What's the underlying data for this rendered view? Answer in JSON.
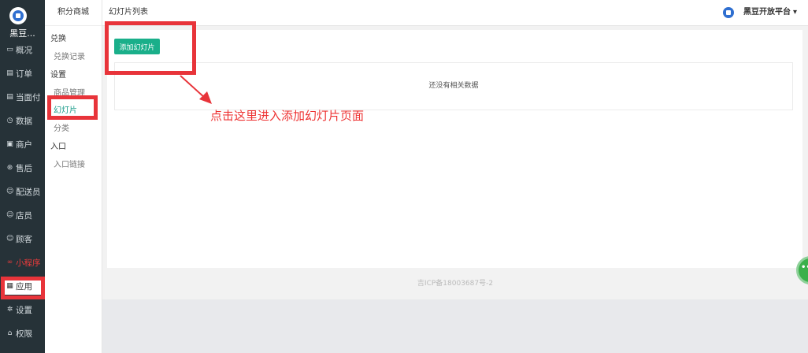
{
  "sidebar": {
    "brand": "黑豆...",
    "items": [
      {
        "label": "概况",
        "icon": "overview-icon"
      },
      {
        "label": "订单",
        "icon": "order-icon"
      },
      {
        "label": "当面付",
        "icon": "pay-icon"
      },
      {
        "label": "数据",
        "icon": "data-icon"
      },
      {
        "label": "商户",
        "icon": "merchant-icon"
      },
      {
        "label": "售后",
        "icon": "aftersale-icon"
      },
      {
        "label": "配送员",
        "icon": "courier-icon"
      },
      {
        "label": "店员",
        "icon": "clerk-icon"
      },
      {
        "label": "顾客",
        "icon": "customer-icon"
      },
      {
        "label": "小程序",
        "icon": "miniprogram-icon"
      },
      {
        "label": "应用",
        "icon": "apps-icon"
      },
      {
        "label": "设置",
        "icon": "settings-icon"
      },
      {
        "label": "权限",
        "icon": "lock-icon"
      }
    ]
  },
  "subnav": {
    "title": "积分商城",
    "group_exchange": "兑换",
    "exchange_records": "兑换记录",
    "group_settings": "设置",
    "product_management": "商品管理",
    "slides": "幻灯片",
    "categories": "分类",
    "group_entry": "入口",
    "entry_link": "入口链接"
  },
  "header": {
    "breadcrumb": "幻灯片列表",
    "platform_name": "黑豆开放平台",
    "caret": "▾"
  },
  "main": {
    "add_button": "添加幻灯片",
    "empty_text": "还没有相关数据"
  },
  "footer": {
    "icp": "吉ICP备18003687号-2"
  },
  "annotation": {
    "text": "点击这里进入添加幻灯片页面",
    "color": "#e8343a"
  },
  "colors": {
    "sidebar_bg": "#263238",
    "accent": "#1aaf8a",
    "alert_red": "#e83b3b"
  }
}
